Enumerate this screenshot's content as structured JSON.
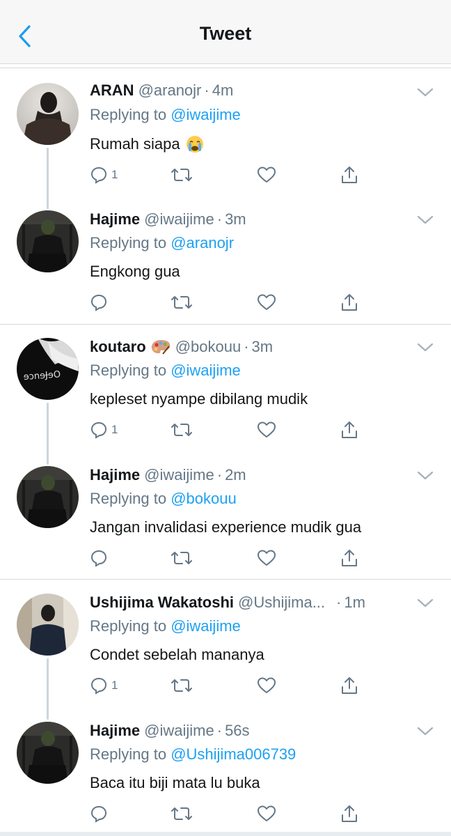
{
  "header": {
    "title": "Tweet"
  },
  "ui": {
    "reply_prefix": "Replying to",
    "dot": "·"
  },
  "tweets": [
    {
      "name": "ARAN",
      "handle": "@aranojr",
      "time": "4m",
      "reply_to": "@iwaijime",
      "text": "Rumah siapa",
      "emoji": "crying-face",
      "reply_count": "1",
      "avatar": "dark-skin-person"
    },
    {
      "name": "Hajime",
      "handle": "@iwaijime",
      "time": "3m",
      "reply_to": "@aranojr",
      "text": "Engkong gua",
      "reply_count": "",
      "avatar": "masked-person-gym"
    },
    {
      "name": "koutaro",
      "handle": "@bokouu",
      "time": "3m",
      "reply_to": "@iwaijime",
      "text": "kepleset nyampe dibilang mudik",
      "emoji": "artist-palette",
      "reply_count": "1",
      "avatar": "white-hair-text"
    },
    {
      "name": "Hajime",
      "handle": "@iwaijime",
      "time": "2m",
      "reply_to": "@bokouu",
      "text": "Jangan invalidasi experience mudik gua",
      "reply_count": "",
      "avatar": "masked-person-gym"
    },
    {
      "name": "Ushijima Wakatoshi",
      "handle": "@Ushijima...",
      "time": "1m",
      "reply_to": "@iwaijime",
      "text": "Condet sebelah mananya",
      "reply_count": "1",
      "avatar": "man-in-suit"
    },
    {
      "name": "Hajime",
      "handle": "@iwaijime",
      "time": "56s",
      "reply_to": "@Ushijima006739",
      "text": "Baca itu biji mata lu buka",
      "reply_count": "",
      "avatar": "masked-person-gym"
    }
  ],
  "colors": {
    "accent": "#1da1f2",
    "back": "#1d9bf0",
    "secondary": "#657786",
    "separator": "#d6d9dc"
  }
}
